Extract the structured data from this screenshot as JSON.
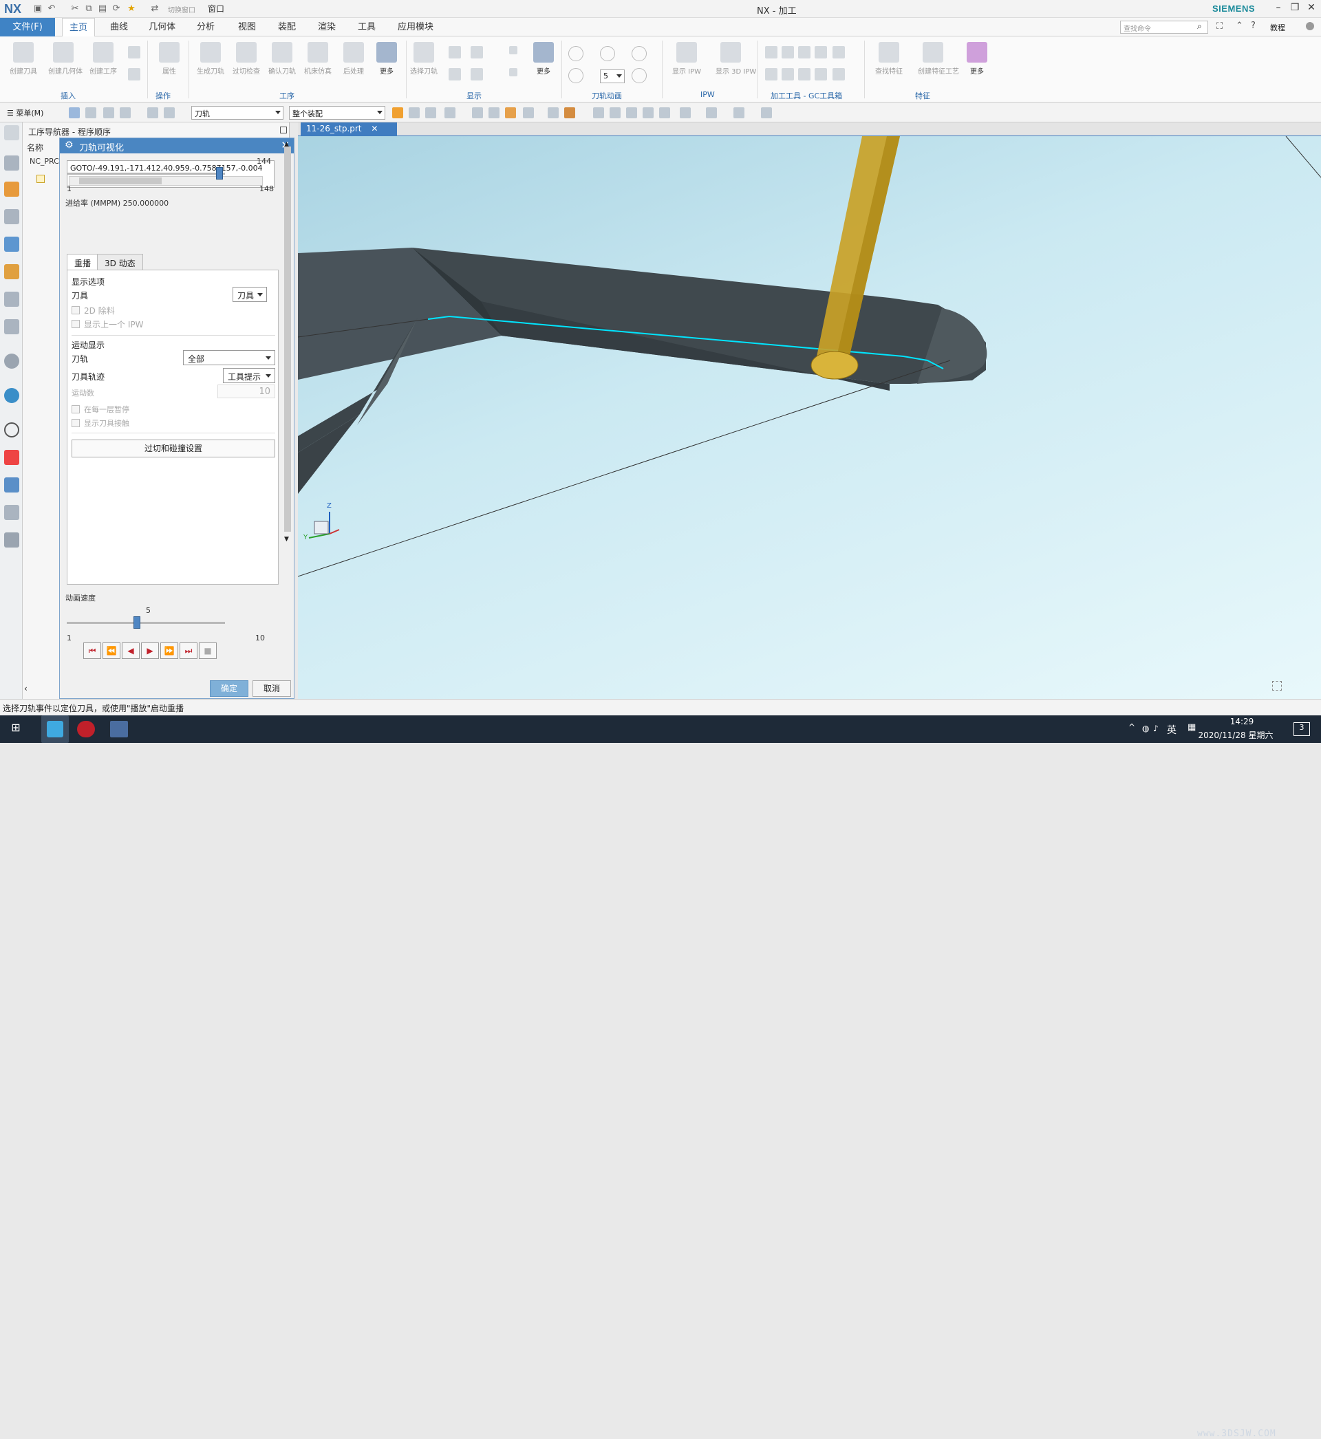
{
  "titlebar": {
    "logo": "NX",
    "switch_window": "切换窗口",
    "window_menu": "窗口",
    "title": "NX - 加工",
    "brand": "SIEMENS"
  },
  "menubar": {
    "file": "文件(F)",
    "tabs": [
      "主页",
      "曲线",
      "几何体",
      "分析",
      "视图",
      "装配",
      "渲染",
      "工具",
      "应用模块"
    ],
    "search_placeholder": "查找命令",
    "tutorial": "教程"
  },
  "ribbon": {
    "buttons": [
      {
        "label": "创建刀具"
      },
      {
        "label": "创建几何体"
      },
      {
        "label": "创建工序"
      },
      {
        "label": "属性"
      },
      {
        "label": "生成刀轨"
      },
      {
        "label": "过切检查"
      },
      {
        "label": "确认刀轨"
      },
      {
        "label": "机床仿真"
      },
      {
        "label": "后处理"
      },
      {
        "label": "更多"
      },
      {
        "label": "选择刀轨"
      },
      {
        "label": "更多"
      },
      {
        "label": "显示 IPW"
      },
      {
        "label": "显示 3D IPW"
      },
      {
        "label": "查找特征"
      },
      {
        "label": "创建特征工艺"
      },
      {
        "label": "更多"
      }
    ],
    "speed_value": "5",
    "groups": [
      "插入",
      "操作",
      "工序",
      "显示",
      "刀轨动画",
      "IPW",
      "加工工具 - GC工具箱",
      "特征"
    ]
  },
  "toolbar2": {
    "menu": "菜单(M)",
    "filter": "刀轨",
    "scope": "整个装配"
  },
  "navigator": {
    "title": "工序导航器 - 程序顺序",
    "col_name": "名称",
    "root": "NC_PRC"
  },
  "dialog": {
    "title": "刀轨可视化",
    "goto": "GOTO/-49.191,-171.412,40.959,-0.7587157,-0.004",
    "slider_current": "144",
    "slider_min": "1",
    "slider_max": "148",
    "slider_fraction": 0.966,
    "feedrate": "进给率 (MMPM) 250.000000",
    "tabs": [
      "重播",
      "3D 动态"
    ],
    "display_options": "显示选项",
    "tool_label": "刀具",
    "tool_value": "刀具",
    "cb_2d": "2D 除料",
    "cb_prev_ipw": "显示上一个 IPW",
    "motion_display": "运动显示",
    "path_label": "刀轨",
    "path_value": "全部",
    "trace_label": "刀具轨迹",
    "trace_value": "工具提示",
    "motion_count_label": "运动数",
    "motion_count": "10",
    "cb_pause": "在每一层暂停",
    "cb_contact": "显示刀具接触",
    "collision_btn": "过切和碰撞设置",
    "anim_speed": "动画速度",
    "speed_current": "5",
    "speed_min": "1",
    "speed_max": "10",
    "speed_fraction": 0.444,
    "ok": "确定",
    "cancel": "取消"
  },
  "viewport": {
    "doc_tab": "11-26_stp.prt",
    "triad_z": "Z",
    "triad_y": "Y"
  },
  "statusbar": {
    "message": "选择刀轨事件以定位刀具，或使用\"播放\"启动重播"
  },
  "taskbar": {
    "ime": "英",
    "time": "14:29",
    "date": "2020/11/28 星期六",
    "notifications": "3",
    "watermark": "www.3DSJW.COM"
  },
  "colors": {
    "accent": "#3f83c5",
    "dialog_title": "#4a86c2",
    "toolpath": "#00e5ff",
    "tool_body": "#c9a227",
    "part": "#4a5356"
  }
}
